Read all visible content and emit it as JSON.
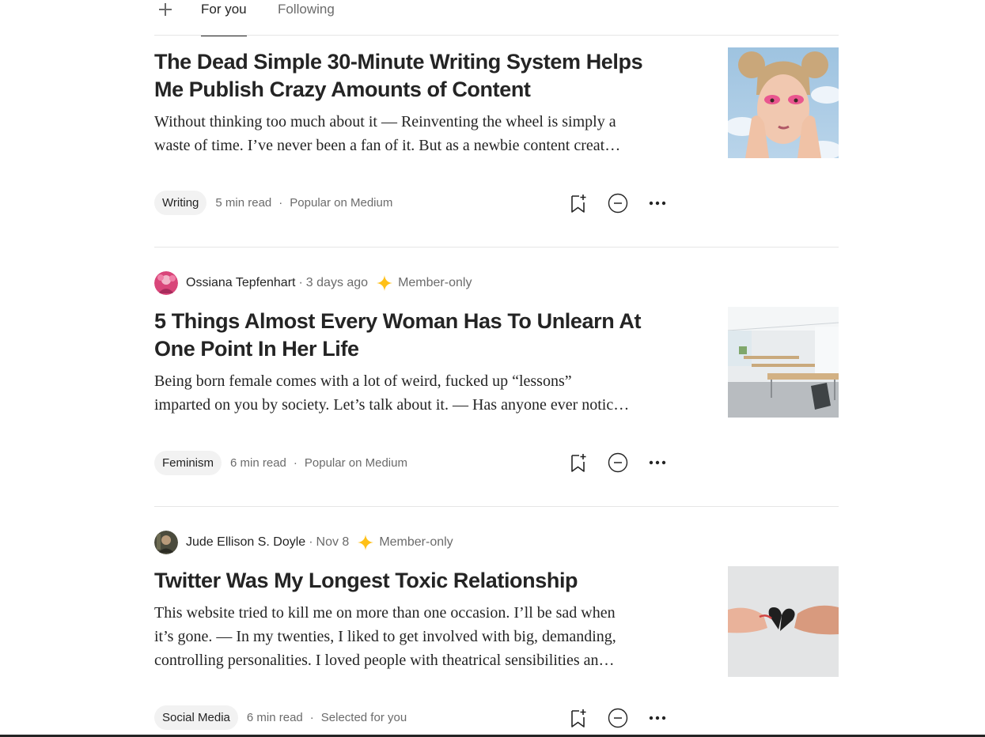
{
  "tabs": {
    "add_label": "+",
    "items": [
      {
        "label": "For you",
        "active": true
      },
      {
        "label": "Following",
        "active": false
      }
    ]
  },
  "articles": [
    {
      "title_lines": [
        "The Dead Simple 30-Minute Writing System Helps",
        "Me Publish Crazy Amounts of Content"
      ],
      "excerpt_lines": [
        "Without thinking too much about it — Reinventing the wheel is simply a",
        "waste of time. I’ve never been a fan of it. But as a newbie content creat…"
      ],
      "tag": "Writing",
      "read_time": "5 min read",
      "sep": "·",
      "source": "Popular on Medium",
      "thumb_icon": "portrait-photo"
    },
    {
      "author": "Ossiana Tepfenhart",
      "author_sep": "·",
      "date": "3 days ago",
      "member_label": "Member-only",
      "title_lines": [
        "5 Things Almost Every Woman Has To Unlearn At",
        "One Point In Her Life"
      ],
      "excerpt_lines": [
        "Being born female comes with a lot of weird, fucked up “lessons”",
        "imparted on you by society. Let’s talk about it. — Has anyone ever notic…"
      ],
      "tag": "Feminism",
      "read_time": "6 min read",
      "sep": "·",
      "source": "Popular on Medium",
      "thumb_icon": "classroom-photo"
    },
    {
      "author": "Jude Ellison S. Doyle",
      "author_sep": "·",
      "date": "Nov 8",
      "member_label": "Member-only",
      "title_lines": [
        "Twitter Was My Longest Toxic Relationship"
      ],
      "excerpt_lines": [
        "This website tried to kill me on more than one occasion. I’ll be sad when",
        "it’s gone. — In my twenties, I liked to get involved with big, demanding,",
        "controlling personalities. I loved people with theatrical sensibilities an…"
      ],
      "tag": "Social Media",
      "read_time": "6 min read",
      "sep": "·",
      "source": "Selected for you",
      "thumb_icon": "broken-heart-photo"
    }
  ],
  "colors": {
    "text": "#242424",
    "muted": "#6b6b6b",
    "member_star": "#ffc017",
    "divider": "#e6e6e6",
    "tag_bg": "#f2f2f2"
  },
  "icons": [
    "plus-icon",
    "bookmark-add-icon",
    "show-less-icon",
    "more-icon",
    "member-star-icon"
  ]
}
